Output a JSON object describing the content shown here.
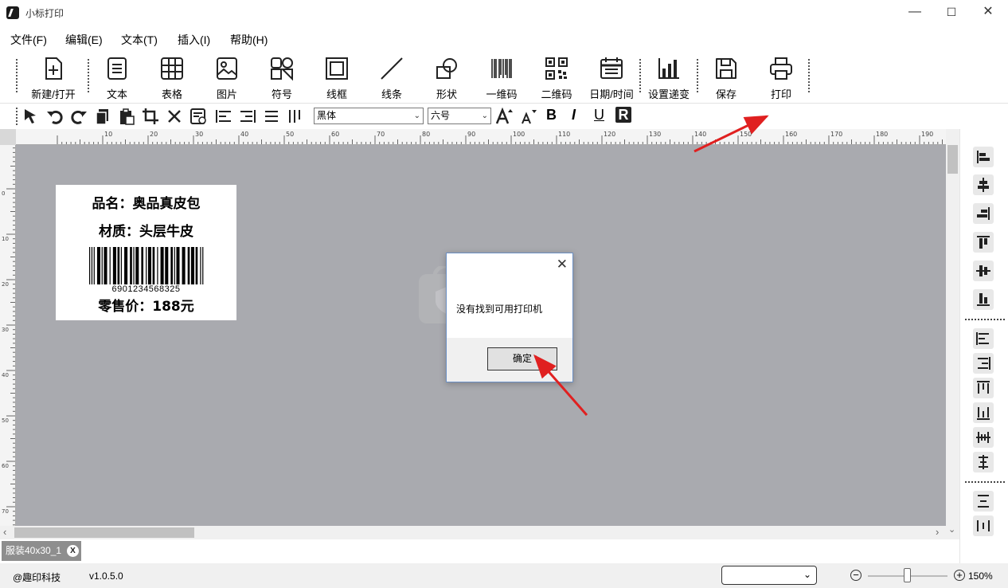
{
  "window": {
    "title": "小标打印",
    "minimize": "—",
    "maximize": "☐",
    "close": "✕"
  },
  "menubar": {
    "items": [
      "文件(F)",
      "编辑(E)",
      "文本(T)",
      "插入(I)",
      "帮助(H)"
    ]
  },
  "toolbar": {
    "items": [
      {
        "label": "新建/打开",
        "icon": "new-file-icon"
      },
      {
        "label": "文本",
        "icon": "text-icon"
      },
      {
        "label": "表格",
        "icon": "table-icon"
      },
      {
        "label": "图片",
        "icon": "image-icon"
      },
      {
        "label": "符号",
        "icon": "symbol-icon"
      },
      {
        "label": "线框",
        "icon": "frame-icon"
      },
      {
        "label": "线条",
        "icon": "line-icon"
      },
      {
        "label": "形状",
        "icon": "shape-icon"
      },
      {
        "label": "一维码",
        "icon": "barcode-icon"
      },
      {
        "label": "二维码",
        "icon": "qrcode-icon"
      },
      {
        "label": "日期/时间",
        "icon": "calendar-icon"
      },
      {
        "label": "设置递变",
        "icon": "bar-chart-icon"
      },
      {
        "label": "保存",
        "icon": "save-icon"
      },
      {
        "label": "打印",
        "icon": "printer-icon"
      }
    ]
  },
  "formatbar": {
    "font_family": "黑体",
    "font_size": "六号",
    "bold": "B",
    "italic": "I",
    "underline": "U",
    "reverse": "R"
  },
  "ruler": {
    "top_ticks": [
      "10",
      "20",
      "30",
      "40",
      "50",
      "60",
      "70",
      "80",
      "90",
      "100",
      "110",
      "120",
      "130",
      "140",
      "150",
      "160",
      "170",
      "180",
      "190"
    ],
    "left_ticks": [
      "0",
      "10",
      "20",
      "30",
      "40",
      "50",
      "60",
      "70"
    ]
  },
  "label": {
    "line1": "品名：奥品真皮包",
    "line2": "材质：头层牛皮",
    "barcode_number": "6901234568325",
    "line3": "零售价：188元"
  },
  "dialog": {
    "close": "✕",
    "message": "没有找到可用打印机",
    "ok": "确定"
  },
  "doctab": {
    "name": "服装40x30_1",
    "close": "X"
  },
  "statusbar": {
    "company": "@趣印科技",
    "version": "v1.0.5.0",
    "printer_select": "",
    "zoom": "150%",
    "zoom_level": 0.5
  },
  "colors": {
    "canvas_bg": "#a9aaaf",
    "annotation_arrow": "#e02020",
    "dialog_border": "#6a8fc4"
  }
}
